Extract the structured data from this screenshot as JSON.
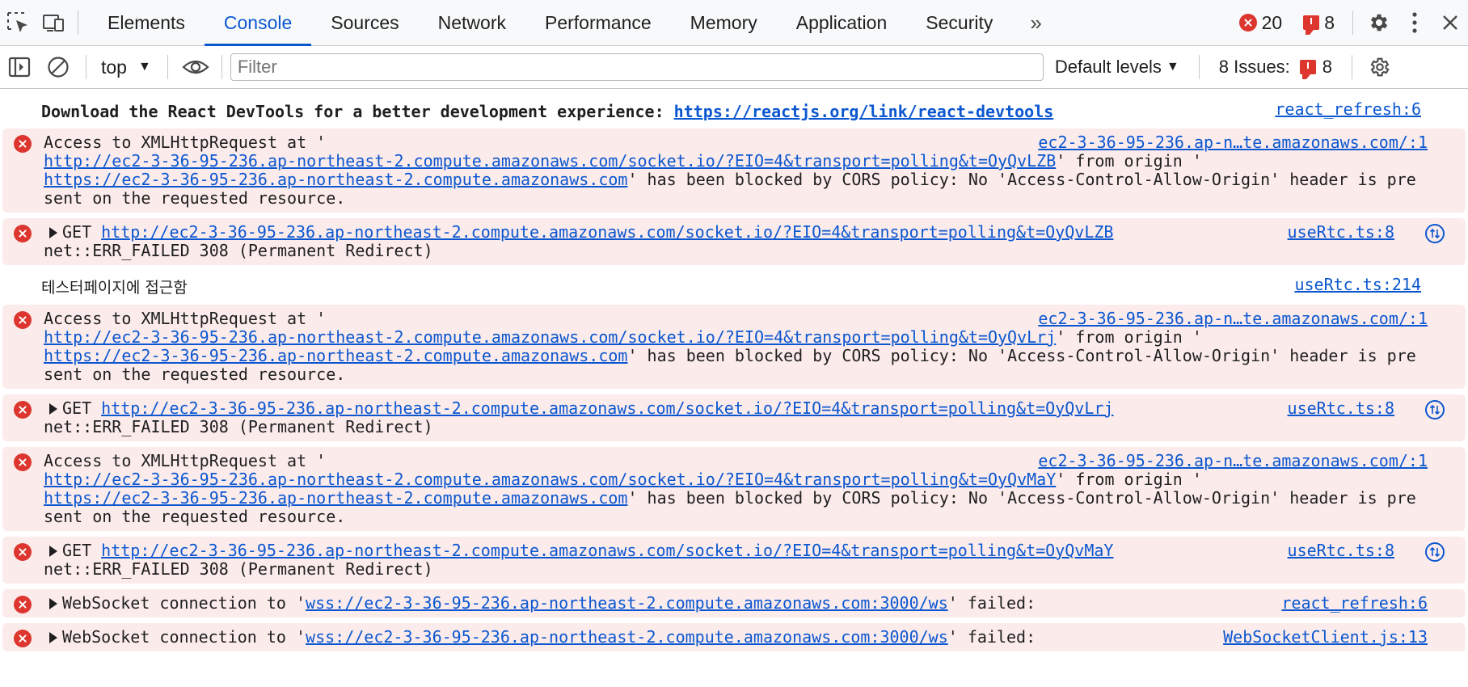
{
  "tabs": {
    "items": [
      "Elements",
      "Console",
      "Sources",
      "Network",
      "Performance",
      "Memory",
      "Application",
      "Security"
    ],
    "active": "Console",
    "more_label": "»"
  },
  "counters": {
    "errors": "20",
    "issues": "8"
  },
  "toolbar": {
    "context": "top",
    "filter_placeholder": "Filter",
    "levels": "Default levels",
    "issues_label": "8 Issues:",
    "issues_count": "8"
  },
  "messages": [
    {
      "type": "info",
      "text_bold": "Download the React DevTools for a better development experience: ",
      "link": "https://reactjs.org/link/react-devtools",
      "source": "react_refresh:6"
    },
    {
      "type": "error",
      "prefix": "Access to XMLHttpRequest at '",
      "url": "http://ec2-3-36-95-236.ap-northeast-2.compute.amazonaws.com/socket.io/?EIO=4&transport=polling&t=OyQvLZB",
      "mid": "' from origin '",
      "origin": "https://ec2-3-36-95-236.ap-northeast-2.compute.amazonaws.com",
      "suffix": "' has been blocked by CORS policy: No 'Access-Control-Allow-Origin' header is present on the requested resource.",
      "source": "ec2-3-36-95-236.ap-n…te.amazonaws.com/:1"
    },
    {
      "type": "error-get",
      "method": "GET ",
      "url": "http://ec2-3-36-95-236.ap-northeast-2.compute.amazonaws.com/socket.io/?EIO=4&transport=polling&t=OyQvLZB",
      "status": "net::ERR_FAILED 308 (Permanent Redirect)",
      "source": "useRtc.ts:8"
    },
    {
      "type": "log",
      "text": "테스터페이지에 접근함",
      "source": "useRtc.ts:214"
    },
    {
      "type": "error",
      "prefix": "Access to XMLHttpRequest at '",
      "url": "http://ec2-3-36-95-236.ap-northeast-2.compute.amazonaws.com/socket.io/?EIO=4&transport=polling&t=OyQvLrj",
      "mid": "' from origin '",
      "origin": "https://ec2-3-36-95-236.ap-northeast-2.compute.amazonaws.com",
      "suffix": "' has been blocked by CORS policy: No 'Access-Control-Allow-Origin' header is present on the requested resource.",
      "source": "ec2-3-36-95-236.ap-n…te.amazonaws.com/:1"
    },
    {
      "type": "error-get",
      "method": "GET ",
      "url": "http://ec2-3-36-95-236.ap-northeast-2.compute.amazonaws.com/socket.io/?EIO=4&transport=polling&t=OyQvLrj",
      "status": "net::ERR_FAILED 308 (Permanent Redirect)",
      "source": "useRtc.ts:8"
    },
    {
      "type": "error",
      "prefix": "Access to XMLHttpRequest at '",
      "url": "http://ec2-3-36-95-236.ap-northeast-2.compute.amazonaws.com/socket.io/?EIO=4&transport=polling&t=OyQvMaY",
      "mid": "' from origin '",
      "origin": "https://ec2-3-36-95-236.ap-northeast-2.compute.amazonaws.com",
      "suffix": "' has been blocked by CORS policy: No 'Access-Control-Allow-Origin' header is present on the requested resource.",
      "source": "ec2-3-36-95-236.ap-n…te.amazonaws.com/:1"
    },
    {
      "type": "error-get",
      "method": "GET ",
      "url": "http://ec2-3-36-95-236.ap-northeast-2.compute.amazonaws.com/socket.io/?EIO=4&transport=polling&t=OyQvMaY",
      "status": "net::ERR_FAILED 308 (Permanent Redirect)",
      "source": "useRtc.ts:8"
    },
    {
      "type": "error-ws",
      "prefix": "WebSocket connection to '",
      "url": "wss://ec2-3-36-95-236.ap-northeast-2.compute.amazonaws.com:3000/ws",
      "suffix": "' failed:",
      "source": "react_refresh:6"
    },
    {
      "type": "error-ws",
      "prefix": "WebSocket connection to '",
      "url": "wss://ec2-3-36-95-236.ap-northeast-2.compute.amazonaws.com:3000/ws",
      "suffix": "' failed:",
      "source": "WebSocketClient.js:13"
    }
  ],
  "colors": {
    "accent": "#0b57d0",
    "error_red": "#dc362e",
    "error_bg": "#fcebeb"
  },
  "icons": {
    "inspect": "inspect-element-icon",
    "device": "device-toolbar-icon",
    "settings": "gear-icon",
    "menu": "kebab-menu-icon",
    "close": "close-icon",
    "sidebar": "sidebar-toggle-icon",
    "clear": "clear-console-icon",
    "eye": "live-expression-eye-icon",
    "network": "network-request-icon"
  }
}
